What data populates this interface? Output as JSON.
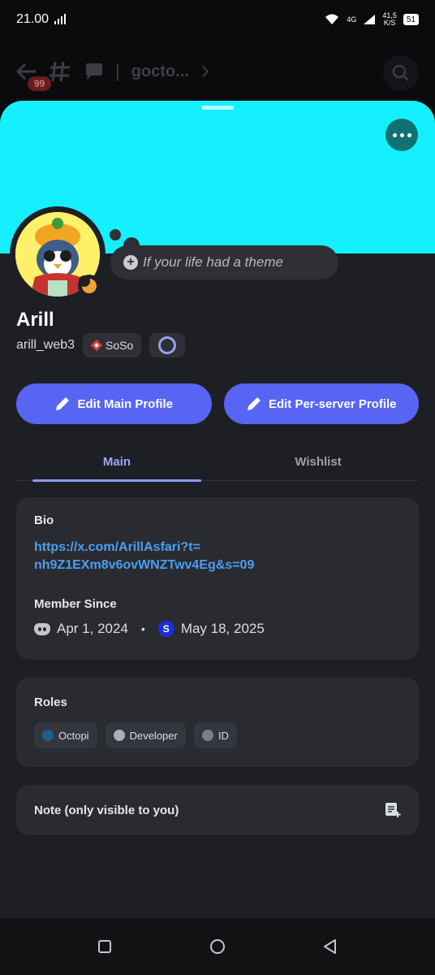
{
  "status_bar": {
    "time": "21.00",
    "network": "4G",
    "speed": "41,5",
    "speed_unit": "K/S",
    "battery": "51"
  },
  "background_header": {
    "unread_count": "99",
    "channel_name": "gocto..."
  },
  "profile": {
    "banner_color": "#14f0ff",
    "custom_status_placeholder": "If your life had a theme",
    "display_name": "Arill",
    "username": "arill_web3",
    "server_tag": "SoSo"
  },
  "actions": {
    "edit_main": "Edit Main Profile",
    "edit_server": "Edit Per-server Profile"
  },
  "tabs": [
    {
      "label": "Main",
      "active": true
    },
    {
      "label": "Wishlist",
      "active": false
    }
  ],
  "bio": {
    "title": "Bio",
    "link_line1": "https://x.com/ArillAsfari?t=",
    "link_line2": "nh9Z1EXm8v6ovWNZTwv4Eg&s=09"
  },
  "member_since": {
    "title": "Member Since",
    "discord_date": "Apr 1, 2024",
    "server_date": "May 18, 2025"
  },
  "roles": {
    "title": "Roles",
    "items": [
      {
        "name": "Octopi",
        "color": "#1d5f8a"
      },
      {
        "name": "Developer",
        "color": "#a5b1bc"
      },
      {
        "name": "ID",
        "color": "#70848d"
      }
    ]
  },
  "note": {
    "label": "Note (only visible to you)"
  },
  "colors": {
    "accent": "#5865f2",
    "link": "#4b9fef",
    "status_idle": "#f0a232"
  }
}
